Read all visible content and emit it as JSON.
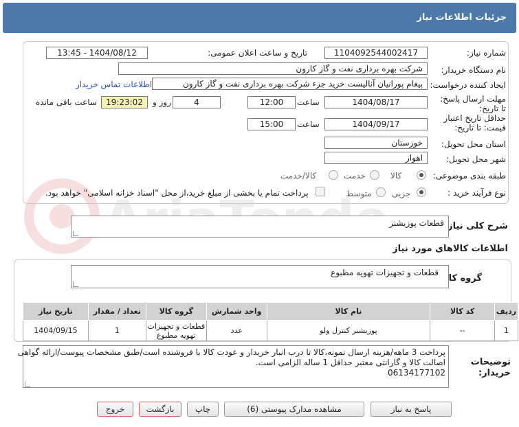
{
  "header": {
    "title": "جزئیات اطلاعات نیاز"
  },
  "form": {
    "need_number_label": "شماره نیاز:",
    "need_number": "1104092544002417",
    "announce_label": "تاریخ و ساعت اعلان عمومی:",
    "announce_value": "1404/08/12 - 13:45",
    "buyer_org_label": "نام دستگاه خریدار:",
    "buyer_org": "شرکت بهره برداری نفت و گاز کارون",
    "creator_label": "ایجاد کننده درخواست:",
    "creator": "پیغام پورانیان آنالیست خرید جزء شرکت بهره برداری نفت و گاز کارون",
    "contact_link": "اطلاعات تماس خریدار",
    "deadline_label": "مهلت ارسال پاسخ: تا تاریخ:",
    "deadline_date": "1404/08/17",
    "time_label": "ساعت",
    "deadline_time": "12:00",
    "days_value": "4",
    "days_label": "روز و",
    "remaining_time": "19:23:02",
    "remaining_label": "ساعت باقی مانده",
    "validity_label": "حداقل تاریخ اعتبار قیمت: تا تاریخ:",
    "validity_date": "1404/09/17",
    "validity_time": "15:00",
    "province_label": "استان محل تحویل:",
    "province": "خوزستان",
    "city_label": "شهر محل تحویل:",
    "city": "اهواز",
    "category_label": "طبقه بندی موضوعی:",
    "category_options": [
      "کالا",
      "خدمت",
      "کالا/خدمت"
    ],
    "category_selected": "کالا",
    "process_label": "نوع فرآیند خرید :",
    "process_options": [
      "جزیی",
      "متوسط"
    ],
    "process_selected": "جزیی",
    "payment_text": "پرداخت تمام یا بخشی از مبلغ خرید،از محل \"اسناد خزانه اسلامی\" خواهد بود."
  },
  "summary": {
    "label": "شرح کلی نیاز:",
    "value": "قطعات پوزیشنر"
  },
  "items_section": {
    "title": "اطلاعات کالاهای مورد نیاز",
    "group_label": "گروه کالا:",
    "group_value": "قطعات و تجهیزات تهویه مطبوع"
  },
  "table": {
    "headers": [
      "ردیف",
      "کد کالا",
      "نام کالا",
      "واحد شمارش",
      "گروه کالا",
      "تعداد / مقدار",
      "تاریخ نیاز"
    ],
    "rows": [
      [
        "1",
        "--",
        "پوزیشنر کنترل ولو",
        "عدد",
        "قطعات و تجهیزات تهویه مطبوع",
        "1",
        "1404/09/15"
      ]
    ]
  },
  "notes": {
    "label": "توضیحات خریدار:",
    "line1": "پرداخت 3 ماهه/هزینه ارسال نمونه،کالا تا درب انبار خریدار و عودت کالا با فروشنده است/طبق مشخصات پیوست/ارائه گواهی",
    "line2": "اصالت کالا و گارانتی معتبر حداقل 1 ساله الزامی است.",
    "line3": "06134177102"
  },
  "buttons": {
    "reply": "پاسخ به نیاز",
    "attachments": "مشاهده مدارک پیوستی (6)",
    "print": "چاپ",
    "back": "بازگشت",
    "exit": "خروج"
  },
  "watermark_text": "AriaTender.net"
}
